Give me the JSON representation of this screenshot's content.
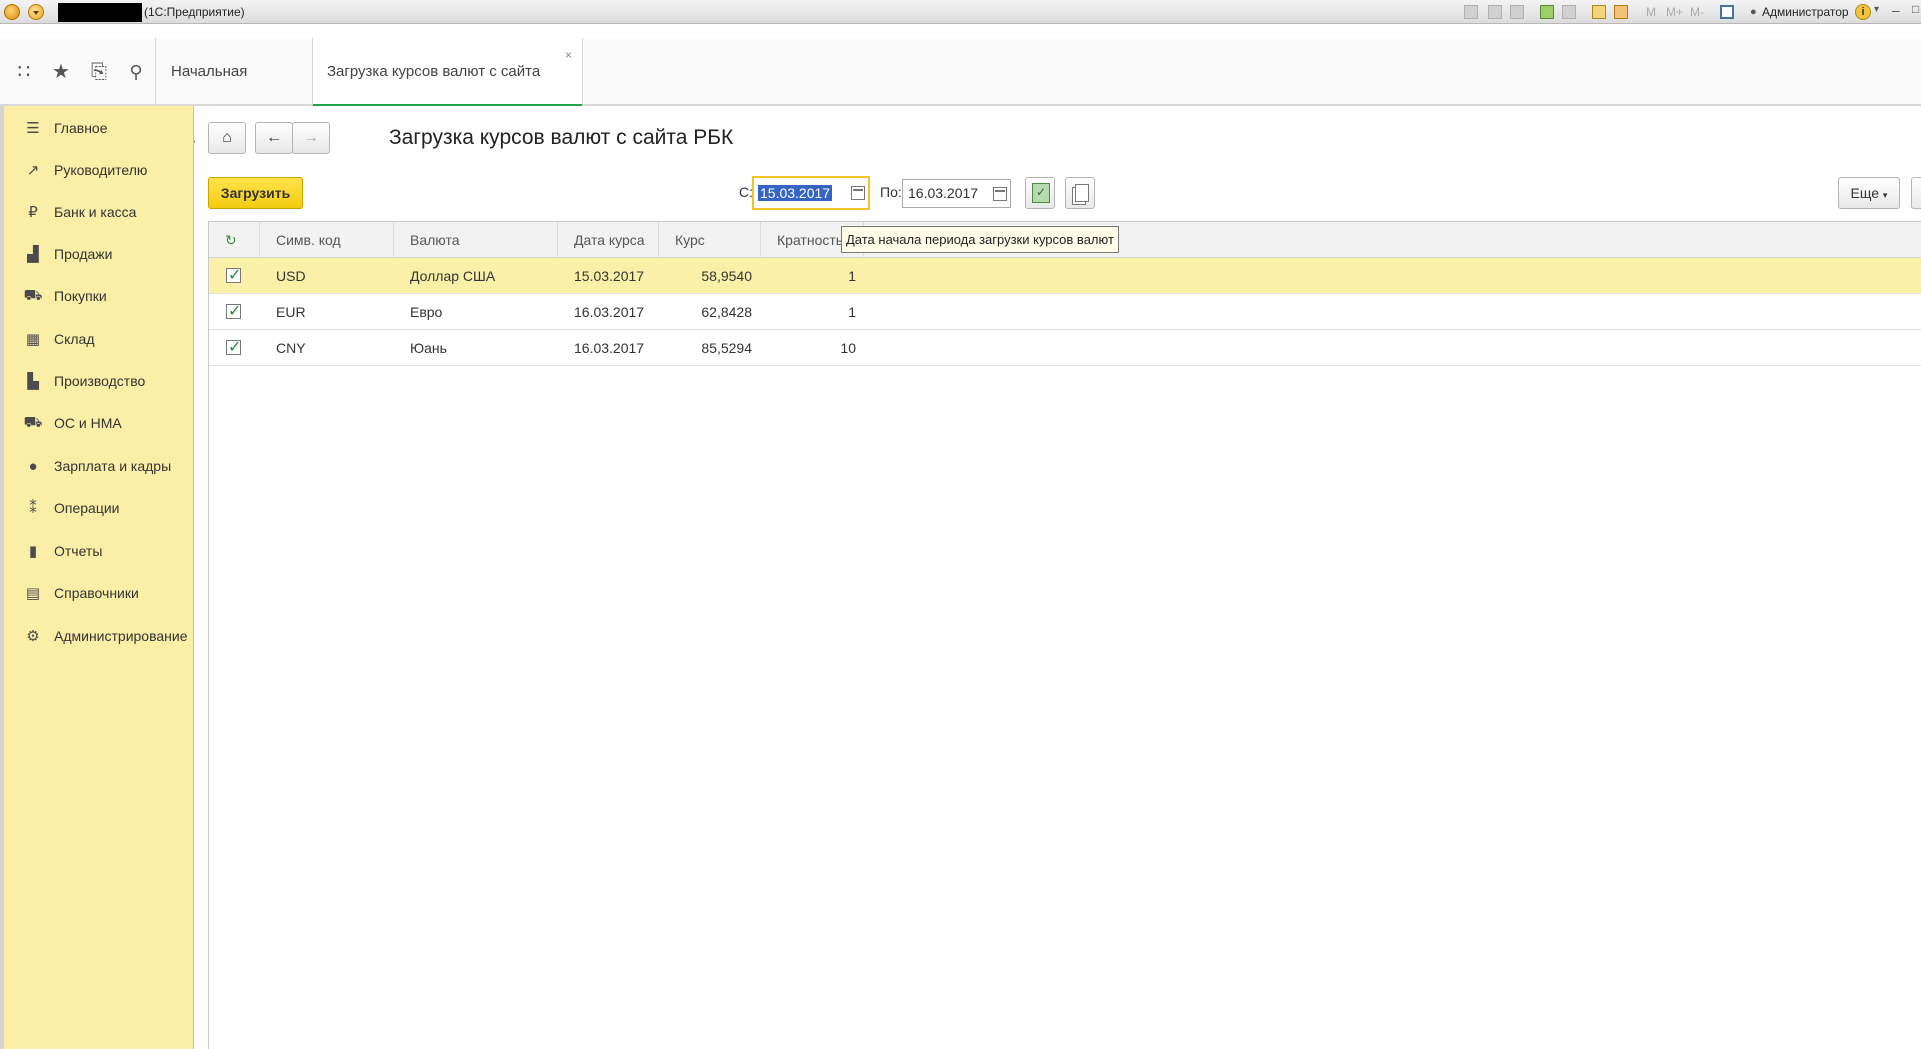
{
  "window": {
    "title": "(1С:Предприятие)",
    "user": "Администратор",
    "mem_buttons": [
      "M",
      "M+",
      "M-"
    ]
  },
  "tabs": {
    "home_label": "Начальная страница",
    "active_label": "Загрузка курсов валют с сайта РБК",
    "close_glyph": "×"
  },
  "sidebar": {
    "items": [
      {
        "label": "Главное",
        "icon": "menu-lines-icon",
        "glyph": "☰"
      },
      {
        "label": "Руководителю",
        "icon": "trend-chart-icon",
        "glyph": "↗"
      },
      {
        "label": "Банк и касса",
        "icon": "ruble-coin-icon",
        "glyph": "₽"
      },
      {
        "label": "Продажи",
        "icon": "shopping-bag-icon",
        "glyph": "▟"
      },
      {
        "label": "Покупки",
        "icon": "shopping-cart-icon",
        "glyph": "⛟"
      },
      {
        "label": "Склад",
        "icon": "warehouse-grid-icon",
        "glyph": "▦"
      },
      {
        "label": "Производство",
        "icon": "factory-icon",
        "glyph": "▙"
      },
      {
        "label": "ОС и НМА",
        "icon": "truck-icon",
        "glyph": "⛟"
      },
      {
        "label": "Зарплата и кадры",
        "icon": "person-icon",
        "glyph": "●"
      },
      {
        "label": "Операции",
        "icon": "dt-kt-icon",
        "glyph": "⁑"
      },
      {
        "label": "Отчеты",
        "icon": "bar-chart-icon",
        "glyph": "▮"
      },
      {
        "label": "Справочники",
        "icon": "book-icon",
        "glyph": "▤"
      },
      {
        "label": "Администрирование",
        "icon": "gear-icon",
        "glyph": "⚙"
      }
    ]
  },
  "form": {
    "title": "Загрузка курсов валют с сайта РБК",
    "load_label": "Загрузить",
    "from_label": "С:",
    "from_value": "15.03.2017",
    "to_label": "По:",
    "to_value": "16.03.2017",
    "more_label": "Еще",
    "tooltip": "Дата начала периода загрузки курсов валют"
  },
  "table": {
    "columns": [
      "Симв. код",
      "Валюта",
      "Дата курса",
      "Курс",
      "Кратность"
    ],
    "rows": [
      {
        "checked": true,
        "code": "USD",
        "name": "Доллар США",
        "date": "15.03.2017",
        "rate": "58,9540",
        "mult": "1"
      },
      {
        "checked": true,
        "code": "EUR",
        "name": "Евро",
        "date": "16.03.2017",
        "rate": "62,8428",
        "mult": "1"
      },
      {
        "checked": true,
        "code": "CNY",
        "name": "Юань",
        "date": "16.03.2017",
        "rate": "85,5294",
        "mult": "10"
      }
    ]
  },
  "colors": {
    "sidebar_bg": "#fbeea7",
    "accent_yellow": "#f4cb12",
    "tab_active_underline": "#1fa34a",
    "selection_blue": "#3564c4",
    "selected_row": "#fbf0a8"
  }
}
